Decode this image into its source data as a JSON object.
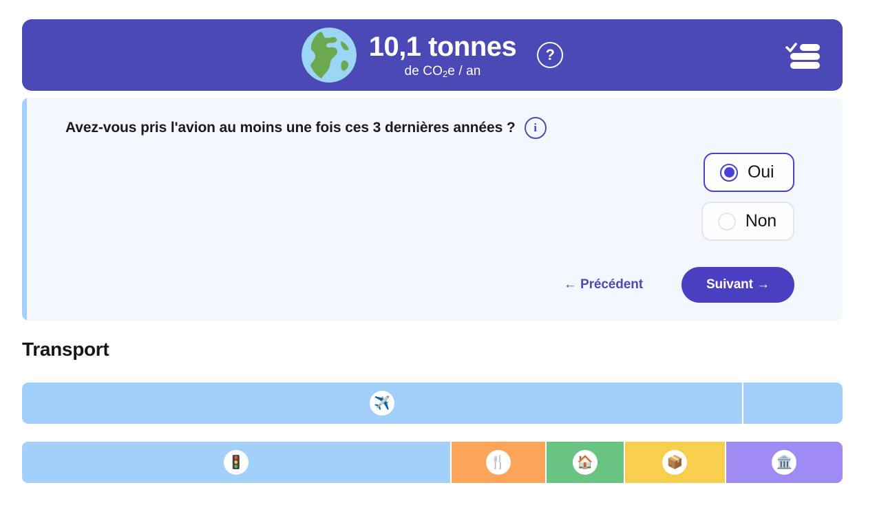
{
  "header": {
    "icon": "globe-europe-africa-icon",
    "value": "10,1 tonnes",
    "unit_prefix": "de CO",
    "unit_sub": "2",
    "unit_suffix": "e / an",
    "help_label": "?",
    "menu_icon": "checklist-menu-icon",
    "background": "#4A49B5"
  },
  "question": {
    "text": "Avez-vous pris l'avion au moins une fois ces 3 dernières années ?",
    "info_label": "i",
    "accent_color": "#A3D0FA",
    "card_background": "#F4F8FE",
    "answers": [
      {
        "label": "Oui",
        "selected": true
      },
      {
        "label": "Non",
        "selected": false
      }
    ],
    "nav": {
      "previous": "← Précédent",
      "next": "Suivant →"
    }
  },
  "section": {
    "title": "Transport"
  },
  "chart_data": {
    "type": "bar",
    "title": "Transport",
    "bars": [
      {
        "name": "transport-detail-bar",
        "segments": [
          {
            "name": "avion",
            "icon": "airplane-icon",
            "glyph": "✈️",
            "color": "#A3D0FA",
            "width_pct": 87.9,
            "show_icon": true
          },
          {
            "name": "autres",
            "icon": "none",
            "glyph": "",
            "color": "#A3D0FA",
            "width_pct": 12.1,
            "show_icon": false
          }
        ]
      },
      {
        "name": "categories-bar",
        "segments": [
          {
            "name": "transport",
            "icon": "traffic-light-icon",
            "glyph": "🚦",
            "color": "#A3D0FA",
            "width_pct": 52.5,
            "show_icon": true
          },
          {
            "name": "alimentation",
            "icon": "fork-and-knife-icon",
            "glyph": "🍴",
            "color": "#FBA45A",
            "width_pct": 11.5,
            "show_icon": true
          },
          {
            "name": "logement",
            "icon": "house-icon",
            "glyph": "🏠",
            "color": "#69C481",
            "width_pct": 9.5,
            "show_icon": true
          },
          {
            "name": "divers",
            "icon": "package-icon",
            "glyph": "📦",
            "color": "#F8CF4C",
            "width_pct": 12.2,
            "show_icon": true
          },
          {
            "name": "services-publics",
            "icon": "classical-building-icon",
            "glyph": "🏛️",
            "color": "#A08BF5",
            "width_pct": 14.3,
            "show_icon": true
          }
        ]
      }
    ],
    "xlabel": "",
    "ylabel": "",
    "legend": "none"
  }
}
